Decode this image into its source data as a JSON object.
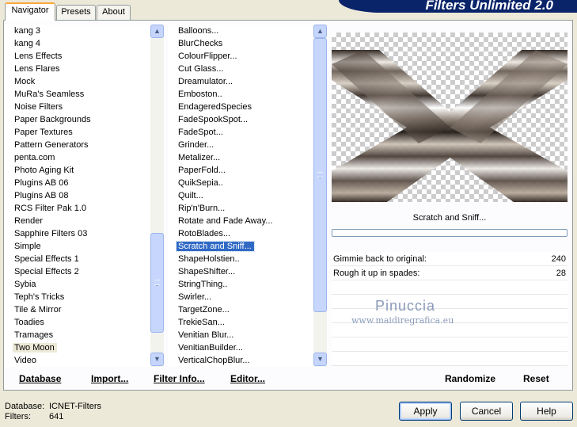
{
  "window": {
    "title": "Filters Unlimited 2.0"
  },
  "tabs": [
    {
      "label": "Navigator",
      "active": true
    },
    {
      "label": "Presets",
      "active": false
    },
    {
      "label": "About",
      "active": false
    }
  ],
  "categories": {
    "items": [
      "kang 3",
      "kang 4",
      "Lens Effects",
      "Lens Flares",
      "Mock",
      "MuRa's Seamless",
      "Noise Filters",
      "Paper Backgrounds",
      "Paper Textures",
      "Pattern Generators",
      "penta.com",
      "Photo Aging Kit",
      "Plugins AB 06",
      "Plugins AB 08",
      "RCS Filter Pak 1.0",
      "Render",
      "Sapphire Filters 03",
      "Simple",
      "Special Effects 1",
      "Special Effects 2",
      "Sybia",
      "Teph's Tricks",
      "Tile & Mirror",
      "Toadies",
      "Tramages",
      "Two Moon",
      "Video"
    ],
    "selected": "Two Moon"
  },
  "filters": {
    "items": [
      "Balloons...",
      "BlurChecks",
      "ColourFlipper...",
      "Cut Glass...",
      "Dreamulator...",
      "Emboston..",
      "EndageredSpecies",
      "FadeSpookSpot...",
      "FadeSpot...",
      "Grinder...",
      "Metalizer...",
      "PaperFold...",
      "QuikSepia..",
      "Quilt...",
      "Rip'n'Burn...",
      "Rotate and Fade Away...",
      "RotoBlades...",
      "Scratch and Sniff...",
      "ShapeHolstien..",
      "ShapeShifter...",
      "StringThing..",
      "Swirler...",
      "TargetZone...",
      "TrekieSan...",
      "Venitian Blur...",
      "VenitianBuilder...",
      "VerticalChopBlur..."
    ],
    "selected": "Scratch and Sniff..."
  },
  "bottom_buttons": {
    "database": "Database",
    "import": "Import...",
    "filter_info": "Filter Info...",
    "editor": "Editor...",
    "randomize": "Randomize",
    "reset": "Reset"
  },
  "current_filter": "Scratch and Sniff...",
  "params": [
    {
      "label": "Gimmie back to original:",
      "value": "240"
    },
    {
      "label": "Rough it up in spades:",
      "value": "28"
    }
  ],
  "watermark": {
    "name": "Pinuccia",
    "site": "www.maidiregrafica.eu"
  },
  "status": {
    "database_label": "Database:",
    "database_value": "ICNET-Filters",
    "filters_label": "Filters:",
    "filters_value": "641"
  },
  "dialog_buttons": {
    "apply": "Apply",
    "cancel": "Cancel",
    "help": "Help"
  },
  "colors": {
    "banner": "#0a246a",
    "selection": "#316ac5",
    "face": "#ece9d8"
  },
  "icons": {
    "scroll_up": "up-arrow-icon",
    "scroll_down": "down-arrow-icon"
  }
}
